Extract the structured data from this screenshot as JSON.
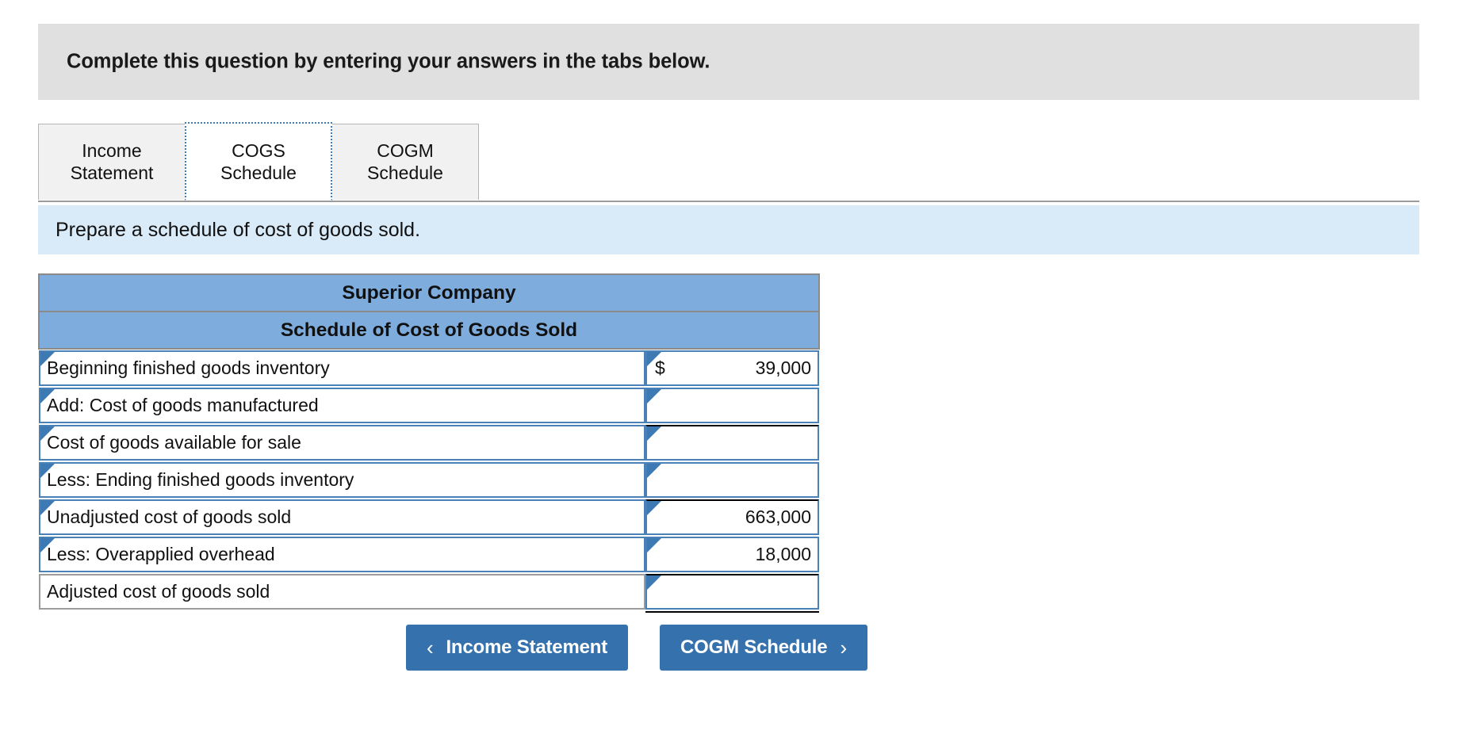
{
  "question": {
    "banner_text": "Complete this question by entering your answers in the tabs below."
  },
  "tabs": [
    {
      "line1": "Income",
      "line2": "Statement",
      "active": false
    },
    {
      "line1": "COGS",
      "line2": "Schedule",
      "active": true
    },
    {
      "line1": "COGM",
      "line2": "Schedule",
      "active": false
    }
  ],
  "subinstruction": {
    "text": "Prepare a schedule of cost of goods sold."
  },
  "schedule": {
    "title_line1": "Superior Company",
    "title_line2": "Schedule of Cost of Goods Sold",
    "rows": [
      {
        "label": "Beginning finished goods inventory",
        "currency": "$",
        "value": "39,000",
        "ruled": false,
        "editable": true,
        "grandtotal": false
      },
      {
        "label": "Add: Cost of goods manufactured",
        "currency": "",
        "value": "",
        "ruled": false,
        "editable": true,
        "grandtotal": false
      },
      {
        "label": "Cost of goods available for sale",
        "currency": "",
        "value": "",
        "ruled": true,
        "editable": true,
        "grandtotal": false
      },
      {
        "label": "Less: Ending finished goods inventory",
        "currency": "",
        "value": "",
        "ruled": false,
        "editable": true,
        "grandtotal": false
      },
      {
        "label": "Unadjusted cost of goods sold",
        "currency": "",
        "value": "663,000",
        "ruled": true,
        "editable": true,
        "grandtotal": false
      },
      {
        "label": "Less: Overapplied overhead",
        "currency": "",
        "value": "18,000",
        "ruled": false,
        "editable": true,
        "grandtotal": false
      },
      {
        "label": "Adjusted cost of goods sold",
        "currency": "",
        "value": "",
        "ruled": true,
        "editable": false,
        "grandtotal": true
      }
    ]
  },
  "nav": {
    "prev_label": "Income Statement",
    "prev_chevron": "‹",
    "next_label": "COGM Schedule",
    "next_chevron": "›"
  },
  "colors": {
    "banner_gray": "#e0e0e0",
    "subinstruction_blue": "#d9eaf8",
    "table_header_blue": "#7eacdc",
    "cell_border_blue": "#4a82b8",
    "marker_blue": "#3d79b3",
    "button_blue": "#3572ad",
    "tab_inactive": "#f1f1f1"
  }
}
